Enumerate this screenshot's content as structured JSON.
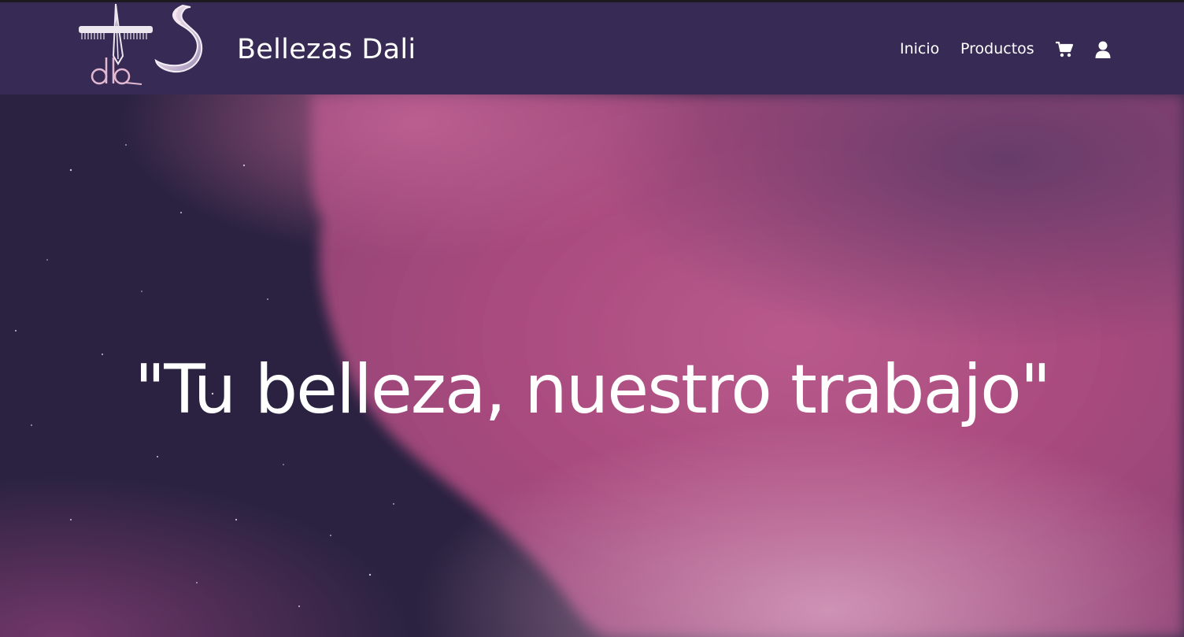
{
  "header": {
    "brand": "Bellezas Dali",
    "logo_icon": "dali-salon-logo",
    "background": "#372a55"
  },
  "nav": {
    "items": [
      {
        "label": "Inicio"
      },
      {
        "label": "Productos"
      }
    ],
    "cart_icon": "shopping-cart-icon",
    "user_icon": "user-icon"
  },
  "hero": {
    "slogan": "\"Tu belleza, nuestro trabajo\"",
    "colors": {
      "sky_dark": "#2a2240",
      "cloud_pink": "#b45486",
      "cloud_highlight": "#c96f9b"
    }
  }
}
